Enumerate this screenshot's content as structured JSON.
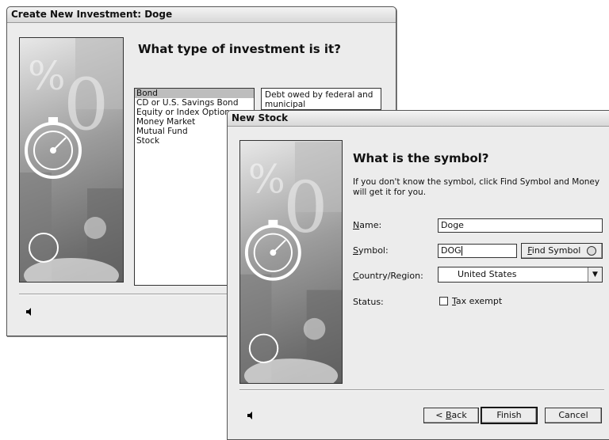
{
  "back_dialog": {
    "title": "Create New Investment: Doge",
    "heading": "What type of investment is it?",
    "types": [
      "Bond",
      "CD or U.S. Savings Bond",
      "Equity or Index Option",
      "Money Market",
      "Mutual Fund",
      "Stock"
    ],
    "selected_index": 0,
    "description": "Debt owed by federal and municipal"
  },
  "front_dialog": {
    "title": "New Stock",
    "heading": "What is the symbol?",
    "help_text": "If you don't know the symbol, click Find Symbol and Money will get it for you.",
    "name_label": "Name:",
    "name_value": "Doge",
    "symbol_label": "Symbol:",
    "symbol_value": "DOG",
    "find_symbol_label": "Find Symbol",
    "country_label": "Country/Region:",
    "country_value": "United States",
    "status_label": "Status:",
    "tax_exempt_label": "Tax exempt",
    "tax_exempt_checked": false,
    "back_label": "< Back",
    "finish_label": "Finish",
    "cancel_label": "Cancel"
  }
}
